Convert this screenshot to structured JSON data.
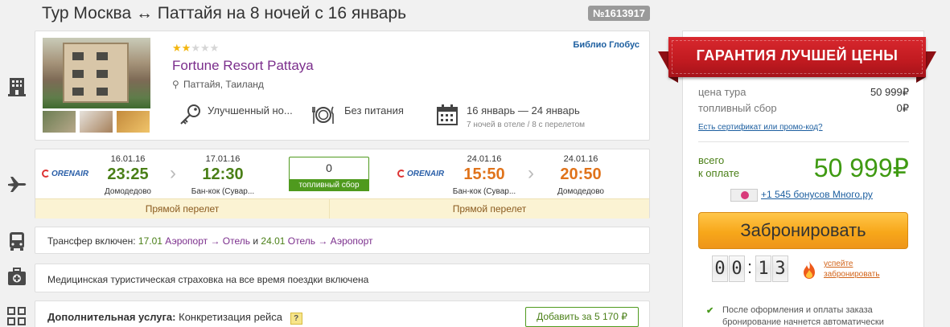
{
  "header": {
    "title": "Тур Москва ↔ Паттайя на 8 ночей с 16 январь",
    "tour_id": "№1613917"
  },
  "hotel": {
    "stars": 2,
    "stars_max": 5,
    "name": "Fortune Resort Pattaya",
    "location": "Паттайя, Таиланд",
    "operator": "Библио Глобус",
    "room": "Улучшенный но...",
    "meal": "Без питания",
    "dates": "16 январь — 24 январь",
    "dates_note": "7 ночей в отеле / 8 с перелетом"
  },
  "flight": {
    "outbound": {
      "airline": "ORENAIR",
      "depart_date": "16.01.16",
      "depart_time": "23:25",
      "depart_airport": "Домодедово",
      "arrive_date": "17.01.16",
      "arrive_time": "12:30",
      "arrive_airport": "Бан-кок (Сувар...",
      "type": "Прямой перелет"
    },
    "fuel": {
      "value": "0",
      "label": "топливный сбор"
    },
    "return": {
      "airline": "ORENAIR",
      "depart_date": "24.01.16",
      "depart_time": "15:50",
      "depart_airport": "Бан-кок (Сувар...",
      "arrive_date": "24.01.16",
      "arrive_time": "20:50",
      "arrive_airport": "Домодедово",
      "type": "Прямой перелет"
    }
  },
  "transfer": {
    "label": "Трансфер включен:",
    "out_date": "17.01",
    "out_route": "Аэропорт → Отель",
    "and": "и",
    "back_date": "24.01",
    "back_route": "Отель → Аэропорт"
  },
  "insurance": {
    "text": "Медицинская туристическая страховка на все время поездки включена"
  },
  "extra": {
    "label": "Дополнительная услуга:",
    "service": "Конкретизация рейса",
    "help": "?",
    "add_button": "Добавить за 5 170 ₽"
  },
  "price": {
    "guarantee": "ГАРАНТИЯ ЛУЧШЕЙ ЦЕНЫ",
    "tour_price_label": "цена тура",
    "tour_price": "50 999₽",
    "fuel_label": "топливный сбор",
    "fuel": "0₽",
    "promo_link": "Есть сертификат или промо-код?",
    "total_label_1": "всего",
    "total_label_2": "к оплате",
    "total": "50 999₽",
    "bonus": "+1 545 бонусов Много.ру",
    "book_button": "Забронировать",
    "timer_digits": [
      "0",
      "0",
      "1",
      "3"
    ],
    "hurry_1": "успейте",
    "hurry_2": "забронировать",
    "note": "После оформления и оплаты заказа бронирование начнется автоматически"
  },
  "colors": {
    "accent_green": "#4a7f17",
    "accent_orange": "#e0731b",
    "hotel_purple": "#7b2e8c",
    "ribbon_red": "#c11a20",
    "button_orange": "#f7a71a"
  },
  "icons": [
    "hotel-icon",
    "plane-icon",
    "bus-icon",
    "medkit-icon",
    "grid-icon",
    "key-icon",
    "plate-icon",
    "calendar-icon",
    "pin-icon",
    "fire-icon",
    "check-icon"
  ]
}
